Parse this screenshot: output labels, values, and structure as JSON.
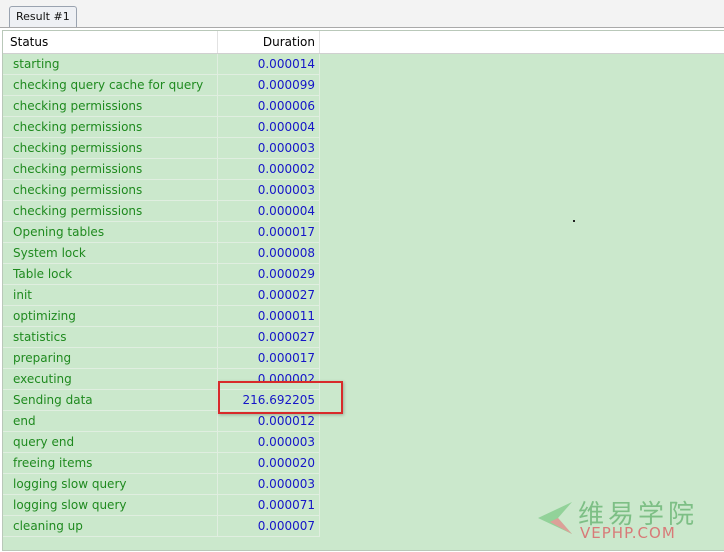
{
  "tabs": [
    {
      "label": "Result #1"
    }
  ],
  "columns": {
    "status": "Status",
    "duration": "Duration"
  },
  "rows": [
    {
      "status": "starting",
      "duration": "0.000014"
    },
    {
      "status": "checking query cache for query",
      "duration": "0.000099"
    },
    {
      "status": "checking permissions",
      "duration": "0.000006"
    },
    {
      "status": "checking permissions",
      "duration": "0.000004"
    },
    {
      "status": "checking permissions",
      "duration": "0.000003"
    },
    {
      "status": "checking permissions",
      "duration": "0.000002"
    },
    {
      "status": "checking permissions",
      "duration": "0.000003"
    },
    {
      "status": "checking permissions",
      "duration": "0.000004"
    },
    {
      "status": "Opening tables",
      "duration": "0.000017"
    },
    {
      "status": "System lock",
      "duration": "0.000008"
    },
    {
      "status": "Table lock",
      "duration": "0.000029"
    },
    {
      "status": "init",
      "duration": "0.000027"
    },
    {
      "status": "optimizing",
      "duration": "0.000011"
    },
    {
      "status": "statistics",
      "duration": "0.000027"
    },
    {
      "status": "preparing",
      "duration": "0.000017"
    },
    {
      "status": "executing",
      "duration": "0.000002"
    },
    {
      "status": "Sending data",
      "duration": "216.692205"
    },
    {
      "status": "end",
      "duration": "0.000012"
    },
    {
      "status": "query end",
      "duration": "0.000003"
    },
    {
      "status": "freeing items",
      "duration": "0.000020"
    },
    {
      "status": "logging slow query",
      "duration": "0.000003"
    },
    {
      "status": "logging slow query",
      "duration": "0.000071"
    },
    {
      "status": "cleaning up",
      "duration": "0.000007"
    }
  ],
  "watermark": {
    "brand_cn": "维易学院",
    "brand_en": "VEPHP.COM"
  },
  "colors": {
    "grid_background": "#cbe8cc",
    "status_text": "#1f8a1f",
    "duration_text": "#1515c8",
    "highlight_border": "#d82a2a"
  }
}
